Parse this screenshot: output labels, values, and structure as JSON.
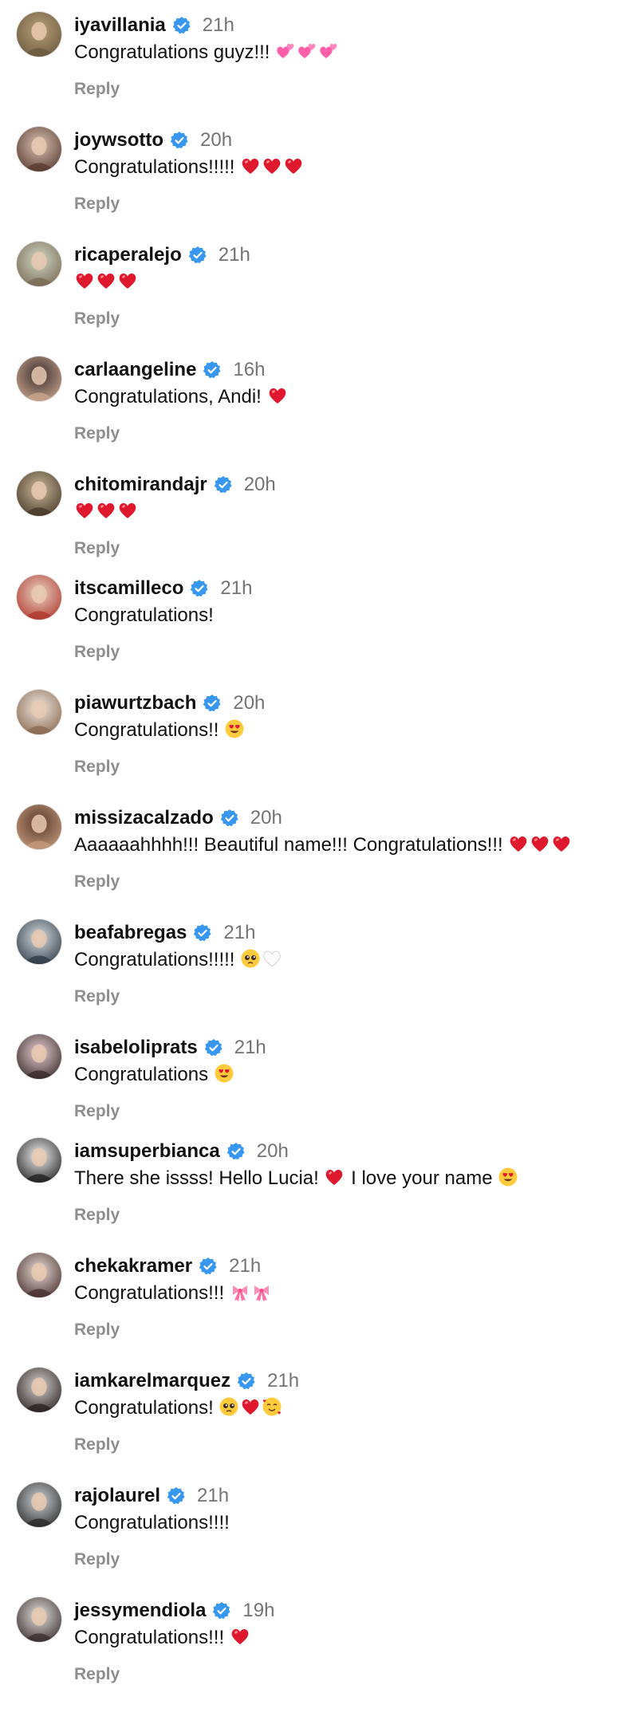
{
  "reply_label": "Reply",
  "colors": {
    "verified_badge": "#3897f0",
    "timestamp": "#737373",
    "reply": "#8e8e8e"
  },
  "comments": [
    {
      "username": "iyavillania",
      "verified": true,
      "time": "21h",
      "text": "Congratulations guyz!!!",
      "emojis": [
        "two-hearts",
        "two-hearts",
        "two-hearts"
      ]
    },
    {
      "username": "joywsotto",
      "verified": true,
      "time": "20h",
      "text": "Congratulations!!!!!",
      "emojis": [
        "red-heart",
        "red-heart",
        "red-heart"
      ]
    },
    {
      "username": "ricaperalejo",
      "verified": true,
      "time": "21h",
      "text": "",
      "emojis": [
        "red-heart",
        "red-heart",
        "red-heart"
      ]
    },
    {
      "username": "carlaangeline",
      "verified": true,
      "time": "16h",
      "text": "Congratulations, Andi!",
      "emojis": [
        "red-heart"
      ]
    },
    {
      "username": "chitomirandajr",
      "verified": true,
      "time": "20h",
      "text": "",
      "emojis": [
        "red-heart",
        "red-heart",
        "red-heart"
      ]
    },
    {
      "username": "itscamilleco",
      "verified": true,
      "time": "21h",
      "text": "Congratulations!",
      "emojis": []
    },
    {
      "username": "piawurtzbach",
      "verified": true,
      "time": "20h",
      "text": "Congratulations!!",
      "emojis": [
        "heart-eyes"
      ]
    },
    {
      "username": "missizacalzado",
      "verified": true,
      "time": "20h",
      "text": "Aaaaaahhhh!!! Beautiful name!!! Congratulations!!!",
      "emojis": [
        "red-heart",
        "red-heart",
        "red-heart"
      ]
    },
    {
      "username": "beafabregas",
      "verified": true,
      "time": "21h",
      "text": "Congratulations!!!!!",
      "emojis": [
        "pleading-face",
        "white-heart"
      ]
    },
    {
      "username": "isabeloliprats",
      "verified": true,
      "time": "21h",
      "text": "Congratulations",
      "emojis": [
        "heart-eyes"
      ]
    },
    {
      "username": "iamsuperbianca",
      "verified": true,
      "time": "20h",
      "text": "There she issss! Hello Lucia!",
      "emojis": [
        "red-heart"
      ],
      "text_after": "I love your name",
      "emojis_after": [
        "heart-eyes"
      ]
    },
    {
      "username": "chekakramer",
      "verified": true,
      "time": "21h",
      "text": "Congratulations!!!",
      "emojis": [
        "ribbon",
        "ribbon"
      ]
    },
    {
      "username": "iamkarelmarquez",
      "verified": true,
      "time": "21h",
      "text": "Congratulations!",
      "emojis": [
        "pleading-face",
        "red-heart",
        "smiling-hearts"
      ]
    },
    {
      "username": "rajolaurel",
      "verified": true,
      "time": "21h",
      "text": "Congratulations!!!!",
      "emojis": []
    },
    {
      "username": "jessymendiola",
      "verified": true,
      "time": "19h",
      "text": "Congratulations!!!",
      "emojis": [
        "red-heart"
      ]
    }
  ]
}
